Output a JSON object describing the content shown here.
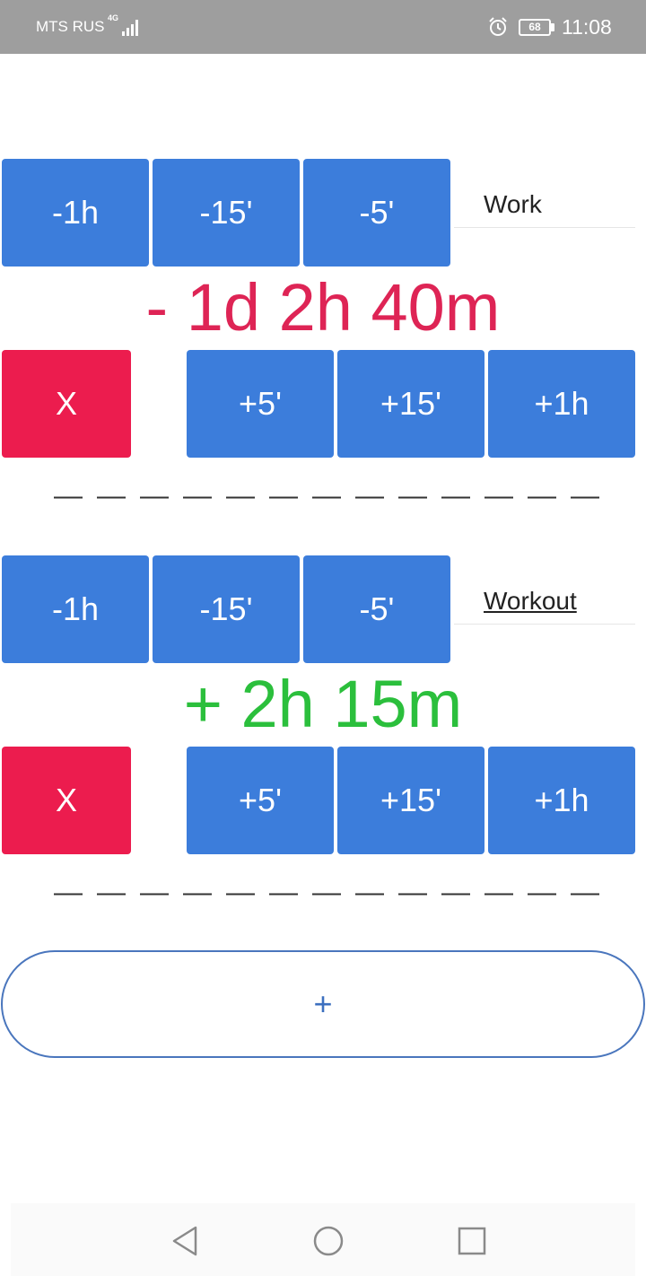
{
  "status_bar": {
    "carrier": "MTS RUS",
    "network": "4G",
    "battery": "68",
    "time": "11:08",
    "icons": [
      "signal-icon",
      "alarm-icon",
      "battery-icon"
    ]
  },
  "timers": [
    {
      "name": "Work",
      "total": "- 1d 2h 40m",
      "total_color": "#de2455",
      "minus_buttons": [
        "-1h",
        "-15'",
        "-5'"
      ],
      "plus_buttons": [
        "+5'",
        "+15'",
        "+1h"
      ],
      "clear_label": "X"
    },
    {
      "name": "Workout",
      "total": "+ 2h 15m",
      "total_color": "#2bbf3c",
      "minus_buttons": [
        "-1h",
        "-15'",
        "-5'"
      ],
      "plus_buttons": [
        "+5'",
        "+15'",
        "+1h"
      ],
      "clear_label": "X"
    }
  ],
  "add_button_label": "+",
  "colors": {
    "button_blue": "#3c7ddb",
    "clear_red": "#ec1c4e",
    "status_bar": "#9e9e9e"
  },
  "nav_bar": {
    "icons": [
      "back-icon",
      "home-icon",
      "recents-icon"
    ]
  }
}
